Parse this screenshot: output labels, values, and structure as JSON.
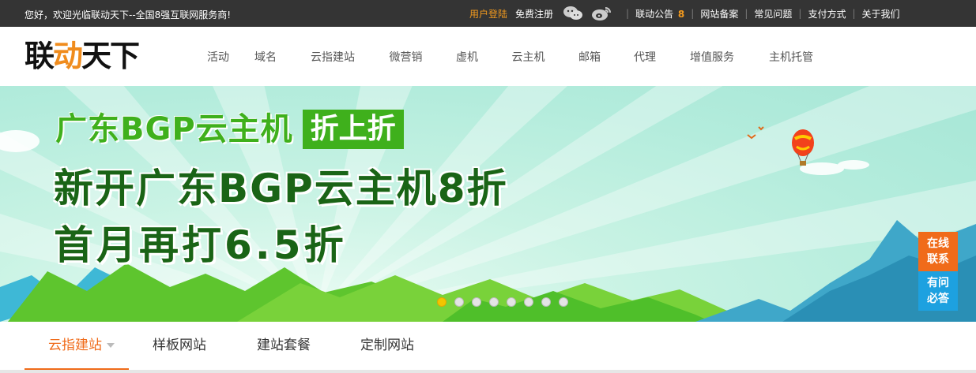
{
  "topbar": {
    "welcome": "您好，欢迎光临联动天下--全国8强互联网服务商!",
    "login": "用户登陆",
    "register": "免费注册",
    "notice_label": "联动公告",
    "notice_count": "8",
    "links": [
      "网站备案",
      "常见问题",
      "支付方式",
      "关于我们"
    ],
    "social_icons": [
      "wechat-icon",
      "weibo-icon"
    ]
  },
  "header": {
    "logo_a": "联",
    "logo_b": "动",
    "logo_c": "天下",
    "nav": [
      "活动",
      "域名",
      "云指建站",
      "微营销",
      "虚机",
      "云主机",
      "邮箱",
      "代理",
      "增值服务",
      "主机托管"
    ]
  },
  "banner": {
    "line1_a": "广东BGP云主机",
    "line1_b": "折上折",
    "line2": "新开广东BGP云主机8折",
    "line3": "首月再打6.5折",
    "slide_count": 8,
    "active_slide": 1,
    "colors": {
      "green": "#3fb01c",
      "dark_green": "#1a6416",
      "sky": "#b3ecdc"
    }
  },
  "float": {
    "contact": [
      "在线",
      "联系"
    ],
    "qa": [
      "有问",
      "必答"
    ]
  },
  "subnav": {
    "tabs": [
      "云指建站",
      "样板网站",
      "建站套餐",
      "定制网站"
    ],
    "active": 0
  }
}
